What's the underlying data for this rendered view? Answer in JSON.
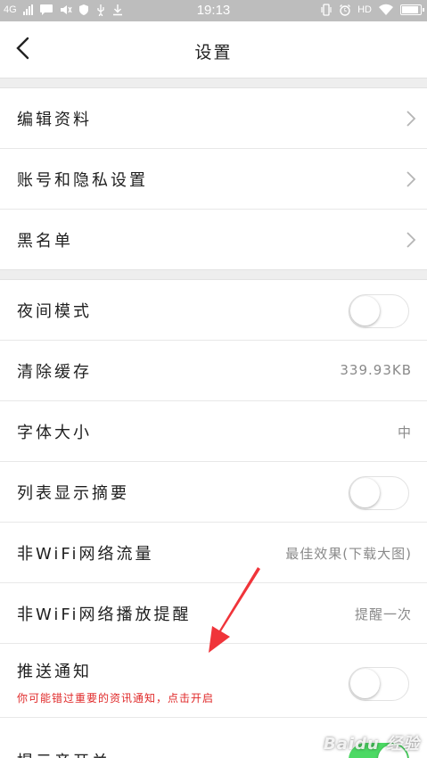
{
  "status_bar": {
    "network": "4G",
    "time": "19:13",
    "hd": "HD"
  },
  "header": {
    "title": "设置",
    "back_icon": "chevron-left-icon"
  },
  "group1": [
    {
      "label": "编辑资料",
      "icon": "chevron-right-icon"
    },
    {
      "label": "账号和隐私设置",
      "icon": "chevron-right-icon"
    },
    {
      "label": "黑名单",
      "icon": "chevron-right-icon"
    }
  ],
  "group2": {
    "night_mode": {
      "label": "夜间模式",
      "on": false
    },
    "clear_cache": {
      "label": "清除缓存",
      "value": "339.93KB"
    },
    "font_size": {
      "label": "字体大小",
      "value": "中"
    },
    "list_summary": {
      "label": "列表显示摘要",
      "on": false
    },
    "non_wifi_traffic": {
      "label": "非WiFi网络流量",
      "value": "最佳效果(下载大图)"
    },
    "non_wifi_play": {
      "label": "非WiFi网络播放提醒",
      "value": "提醒一次"
    },
    "push_notification": {
      "label": "推送通知",
      "subtext": "你可能错过重要的资讯通知，点击开启",
      "on": false
    },
    "sound_switch": {
      "label": "提示音开关",
      "on": true
    }
  },
  "colors": {
    "toggle_on": "#4cd964",
    "warning_text": "#e02a2a",
    "annotation_arrow": "#f0343a"
  },
  "watermark": "Baidu 经验"
}
